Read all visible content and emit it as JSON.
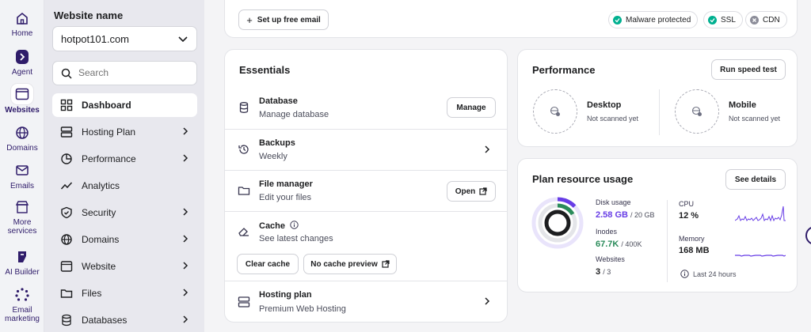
{
  "rail": {
    "items": [
      {
        "label": "Home",
        "icon": "home-icon"
      },
      {
        "label": "Agent",
        "icon": "agent-icon"
      },
      {
        "label": "Websites",
        "icon": "websites-icon"
      },
      {
        "label": "Domains",
        "icon": "globe-icon"
      },
      {
        "label": "Emails",
        "icon": "mail-icon"
      },
      {
        "label1": "More",
        "label2": "services",
        "icon": "store-icon"
      },
      {
        "label": "AI Builder",
        "icon": "ai-builder-icon"
      },
      {
        "label1": "Email",
        "label2": "marketing",
        "icon": "email-marketing-icon"
      }
    ]
  },
  "sidebar": {
    "site_label": "Website name",
    "site_value": "hotpot101.com",
    "search_placeholder": "Search",
    "items": [
      {
        "label": "Dashboard"
      },
      {
        "label": "Hosting Plan"
      },
      {
        "label": "Performance"
      },
      {
        "label": "Analytics"
      },
      {
        "label": "Security"
      },
      {
        "label": "Domains"
      },
      {
        "label": "Website"
      },
      {
        "label": "Files"
      },
      {
        "label": "Databases"
      }
    ]
  },
  "topbar": {
    "email_button": "Set up free email",
    "badges": [
      {
        "label": "Malware protected",
        "color": "#00b090"
      },
      {
        "label": "SSL",
        "color": "#00b090"
      },
      {
        "label": "CDN",
        "color": "#8c8d99"
      }
    ]
  },
  "essentials": {
    "title": "Essentials",
    "rows": [
      {
        "title": "Database",
        "sub": "Manage database",
        "button": "Manage"
      },
      {
        "title": "Backups",
        "sub": "Weekly"
      },
      {
        "title": "File manager",
        "sub": "Edit your files",
        "button": "Open"
      },
      {
        "title": "Cache",
        "sub": "See latest changes",
        "btn1": "Clear cache",
        "btn2": "No cache preview"
      },
      {
        "title": "Hosting plan",
        "sub": "Premium Web Hosting"
      }
    ]
  },
  "performance": {
    "title": "Performance",
    "button": "Run speed test",
    "desktop": {
      "label": "Desktop",
      "status": "Not scanned yet"
    },
    "mobile": {
      "label": "Mobile",
      "status": "Not scanned yet"
    }
  },
  "resources": {
    "title": "Plan resource usage",
    "button": "See details",
    "disk_label": "Disk usage",
    "disk_value": "2.58 GB",
    "disk_total": "/ 20 GB",
    "inodes_label": "Inodes",
    "inodes_value": "67.7K",
    "inodes_total": "/ 400K",
    "websites_label": "Websites",
    "websites_value": "3",
    "websites_total": "/ 3",
    "cpu_label": "CPU",
    "cpu_value": "12 %",
    "memory_label": "Memory",
    "memory_value": "168 MB",
    "range_label": "Last 24 hours",
    "colors": {
      "accent": "#673de6",
      "green": "#00b090"
    }
  }
}
